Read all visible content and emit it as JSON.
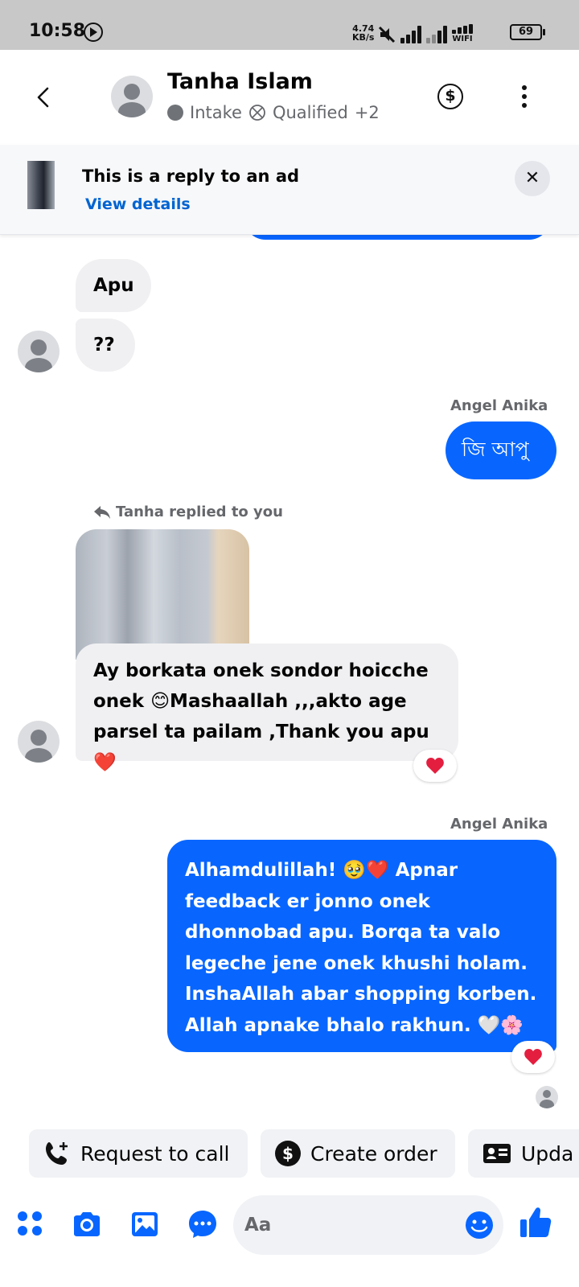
{
  "status_bar": {
    "time": "10:58",
    "speed_value": "4.74",
    "speed_unit": "KB/s",
    "wifi_label": "WIFI",
    "battery": "69"
  },
  "header": {
    "contact_name": "Tanha Islam",
    "tags": [
      "Intake",
      "Qualified",
      "+2"
    ]
  },
  "ad_banner": {
    "title": "This is a reply to an ad",
    "link": "View details"
  },
  "messages": {
    "m1": "Apu",
    "m2": "??",
    "m3_sender": "Angel Anika",
    "m3": "জি আপু",
    "reply_label": "Tanha replied to you",
    "m4": "Ay borkata onek sondor hoicche onek 😊Mashaallah ,,,akto age parsel ta pailam ,Thank you apu ❤️",
    "m5_sender": "Angel Anika",
    "m5": "Alhamdulillah! 🥹❤️ Apnar feedback er jonno onek dhonnobad apu. Borqa ta valo legeche jene onek khushi holam. InshaAllah abar shopping korben. Allah apnake bhalo rakhun. 🤍🌸"
  },
  "quick_actions": [
    "Request to call",
    "Create order",
    "Upda"
  ],
  "composer": {
    "placeholder": "Aa"
  },
  "colors": {
    "outgoing_bubble": "#0866ff",
    "incoming_bubble": "#f0f0f2",
    "accent_icon": "#0866ff",
    "link": "#0064d1"
  }
}
